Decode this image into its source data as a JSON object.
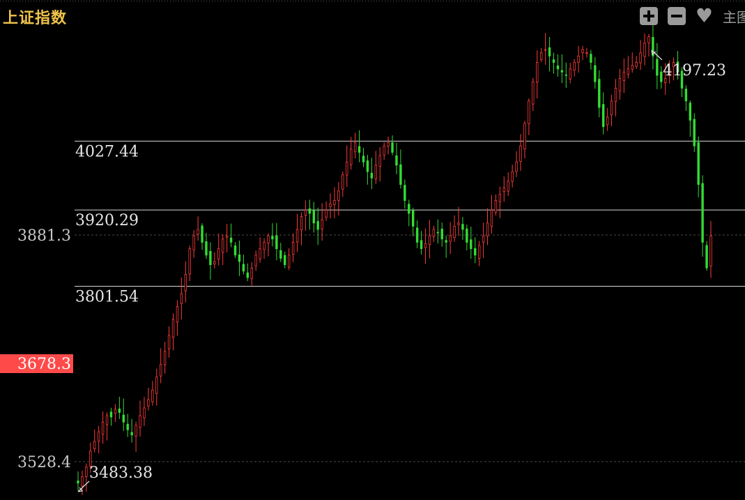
{
  "header": {
    "title": "上证指数",
    "main_label": "主图"
  },
  "toolbar": {
    "zoom_in_icon": "plus-icon",
    "zoom_out_icon": "minus-icon",
    "favorite_icon": "heart-icon"
  },
  "colors": {
    "background": "#000000",
    "up": "#ff3b3b",
    "down": "#33dd33",
    "title": "#f0c44a",
    "axis_text": "#c8c8c8",
    "current_bg": "#ff4a4a"
  },
  "chart_data": {
    "type": "candlestick",
    "y_axis_ticks": [
      "3881.3",
      "3528.4"
    ],
    "y_tick_values": [
      3881.3,
      3528.4
    ],
    "current_price": "3678.3",
    "current_value": 3678.3,
    "horizontal_levels": [
      {
        "label": "4027.44",
        "value": 4027.44
      },
      {
        "label": "3920.29",
        "value": 3920.29
      },
      {
        "label": "3801.54",
        "value": 3801.54
      }
    ],
    "extremes": {
      "high_label": "4197.23",
      "high": 4197.23,
      "low_label": "3483.38",
      "low": 3483.38
    },
    "close_series": [
      3495,
      3505,
      3520,
      3545,
      3560,
      3575,
      3590,
      3600,
      3598,
      3610,
      3605,
      3590,
      3578,
      3570,
      3585,
      3600,
      3612,
      3625,
      3640,
      3660,
      3680,
      3700,
      3725,
      3750,
      3770,
      3790,
      3820,
      3860,
      3880,
      3890,
      3870,
      3850,
      3835,
      3840,
      3860,
      3875,
      3880,
      3870,
      3850,
      3840,
      3825,
      3815,
      3830,
      3850,
      3860,
      3870,
      3880,
      3875,
      3860,
      3845,
      3835,
      3850,
      3870,
      3890,
      3910,
      3920,
      3915,
      3900,
      3890,
      3905,
      3920,
      3930,
      3935,
      3950,
      3975,
      3995,
      4015,
      4025,
      4010,
      3995,
      3980,
      3970,
      3990,
      4005,
      4020,
      4025,
      4010,
      3990,
      3960,
      3935,
      3915,
      3895,
      3870,
      3860,
      3868,
      3880,
      3890,
      3885,
      3875,
      3870,
      3880,
      3895,
      3900,
      3890,
      3870,
      3860,
      3850,
      3865,
      3880,
      3900,
      3920,
      3935,
      3945,
      3955,
      3965,
      3980,
      3995,
      4020,
      4055,
      4090,
      4120,
      4150,
      4165,
      4170,
      4160,
      4150,
      4140,
      4135,
      4130,
      4140,
      4150,
      4160,
      4170,
      4165,
      4150,
      4120,
      4080,
      4050,
      4065,
      4090,
      4110,
      4125,
      4135,
      4140,
      4145,
      4150,
      4165,
      4180,
      4190,
      4160,
      4130,
      4120,
      4125,
      4140,
      4150,
      4135,
      4110,
      4090,
      4060,
      4020,
      3960,
      3870,
      3830,
      3880
    ]
  }
}
